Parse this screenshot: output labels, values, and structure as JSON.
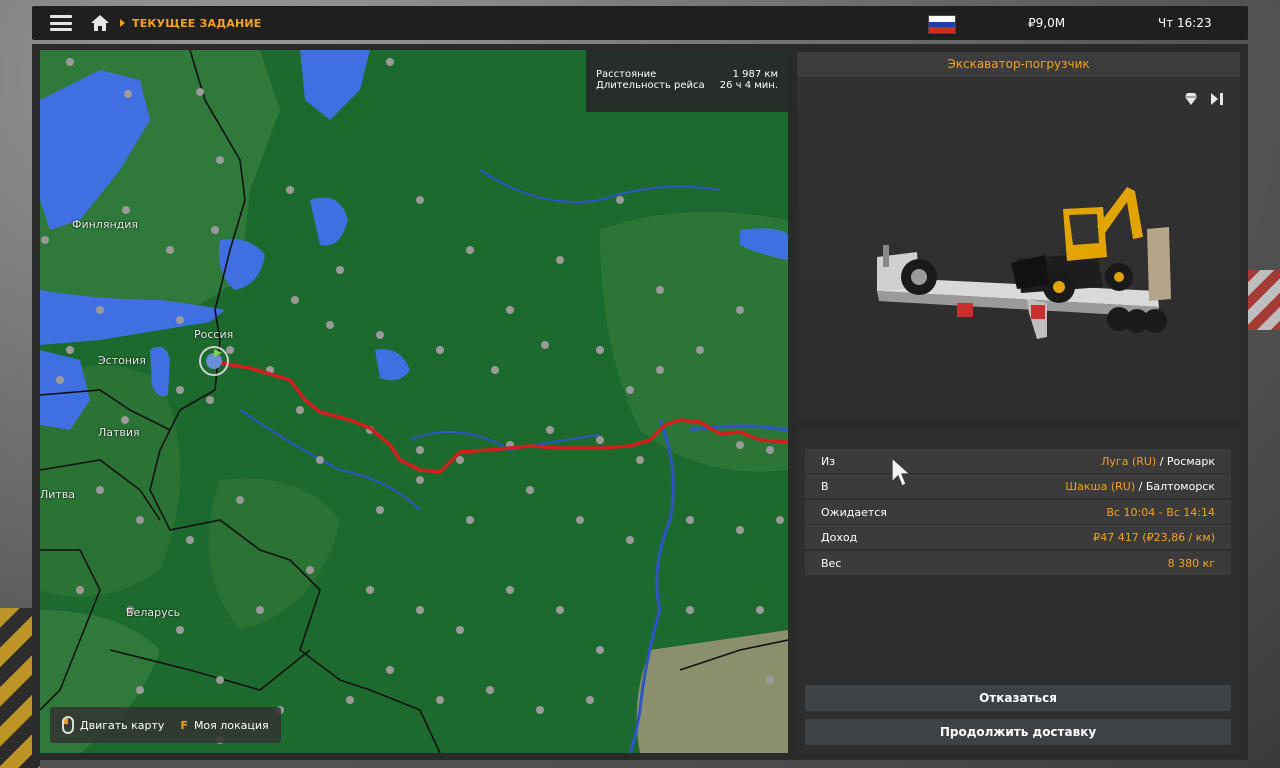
{
  "topbar": {
    "breadcrumb": "ТЕКУЩЕЕ ЗАДАНИЕ",
    "money": "₽9,0M",
    "clock": "Чт 16:23",
    "flag_colors": [
      "#ffffff",
      "#1c3fae",
      "#d52b1e"
    ]
  },
  "map": {
    "info": {
      "distance_label": "Расстояние",
      "distance_value": "1 987 км",
      "duration_label": "Длительность рейса",
      "duration_value": "26 ч 4 мин."
    },
    "countries": {
      "finland": "Финляндия",
      "russia": "Россия",
      "estonia": "Эстония",
      "latvia": "Латвия",
      "lithuania": "Литва",
      "belarus": "Беларусь"
    },
    "hint": {
      "move_map": "Двигать карту",
      "location_key": "F",
      "my_location": "Моя локация"
    },
    "colors": {
      "land": "#1d6a2e",
      "water": "#3f6fe0",
      "route": "#d41e1e"
    }
  },
  "cargo": {
    "title": "Экскаватор-погрузчик"
  },
  "details": {
    "from_label": "Из",
    "from_city": "Луга (RU)",
    "from_company": " / Росмарк",
    "to_label": "В",
    "to_city": "Шакша (RU)",
    "to_company": " / Балтоморск",
    "expected_label": "Ожидается",
    "expected_value": "Вс 10:04 - Вс 14:14",
    "income_label": "Доход",
    "income_value": "₽47 417 (₽23,86 / км)",
    "weight_label": "Вес",
    "weight_value": "8 380 кг"
  },
  "buttons": {
    "decline": "Отказаться",
    "continue": "Продолжить доставку"
  },
  "accent_color": "#f2a21a"
}
